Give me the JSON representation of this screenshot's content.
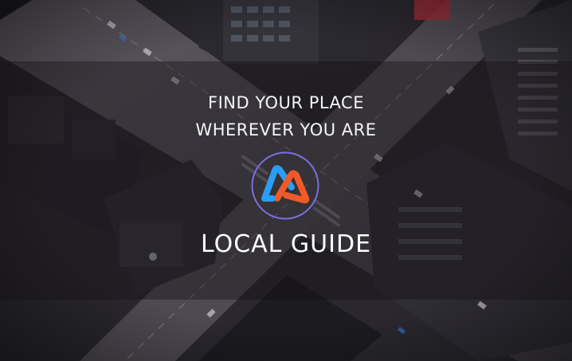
{
  "hero": {
    "tagline_line1": "FIND YOUR PLACE",
    "tagline_line2": "WHEREVER YOU ARE",
    "brand_name": "LOCAL GUIDE"
  },
  "logo": {
    "icon": "m-monogram-icon",
    "color_left": "#2a9df4",
    "color_right": "#f05a28",
    "ring_color": "#7b6fe0"
  },
  "background": {
    "icon": "aerial-city-intersection-image"
  }
}
